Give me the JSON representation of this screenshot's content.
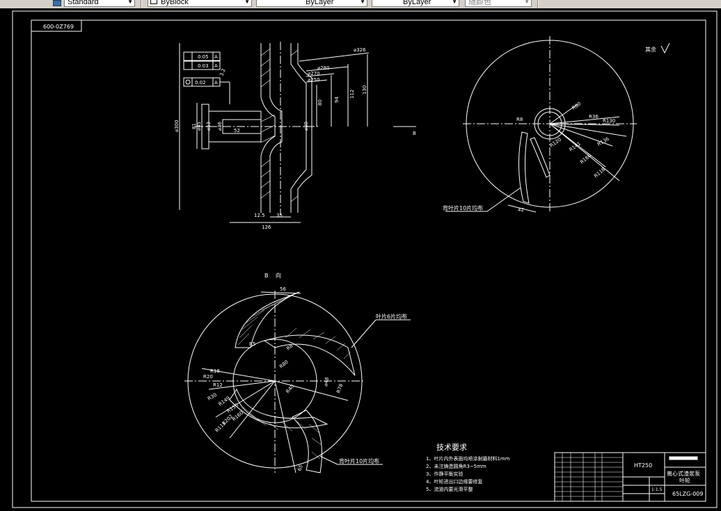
{
  "toolbar": {
    "text_style": "Standard",
    "layer": "ByBlock",
    "linetype": "ByLayer",
    "lineweight": "ByLayer",
    "plot_style": "随颜色"
  },
  "drawing": {
    "drawing_number_box": "600-0Z769",
    "tolerances": [
      "0.05",
      "0.03",
      "0.02"
    ],
    "datum": "A",
    "roughness_note": "其余",
    "dims_section": [
      "⌀326",
      "⌀280",
      "⌀270",
      "⌀250",
      "⌀300",
      "⌀53",
      "⌀45",
      "⌀36",
      "⌀80",
      "81",
      "52",
      "80",
      "94",
      "112",
      "130",
      "126",
      "35",
      "12.5",
      "3.2"
    ],
    "view_arrow_label": "B",
    "dims_top_right": [
      "R8",
      "R80",
      "R36",
      "R130",
      "R120",
      "R141",
      "R160",
      "R136",
      "R118",
      "42"
    ],
    "back_vane_note_1": "背叶片10片均布",
    "view_label_b": "B 向",
    "vane_note": "叶片6片均布",
    "back_vane_note_2": "背叶片10片均布",
    "dims_view_b": [
      "56",
      "R5",
      "R8",
      "R80",
      "R18",
      "R20",
      "R12",
      "R30",
      "R40",
      "R149",
      "R150",
      "R160",
      "R111",
      "R202",
      "R78",
      "⌀48",
      "65"
    ],
    "tech_title": "技术要求",
    "tech_items": [
      "1、叶片内外表面均喷涂耐磨材料1mm",
      "2、未注铸造圆角R3~5mm",
      "3、作静平衡实验",
      "4、叶轮进出口边缘要修复",
      "5、流道内要光滑平整"
    ],
    "title_block": {
      "material": "HT250",
      "product_name": "离心式渣浆泵",
      "part_name": "叶轮",
      "drawing_no": "65LZG-009",
      "scale": "1:1.5"
    }
  }
}
